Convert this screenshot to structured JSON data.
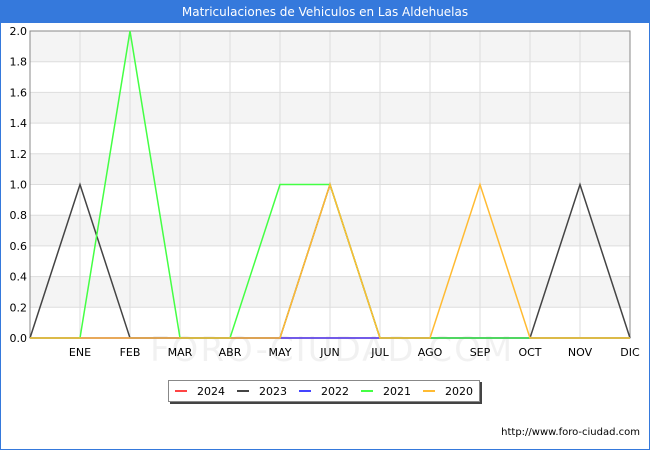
{
  "title": "Matriculaciones de Vehiculos en Las Aldehuelas",
  "footer_url": "http://www.foro-ciudad.com",
  "watermark": "FORO-CIUDAD.COM",
  "chart_data": {
    "type": "line",
    "title": "Matriculaciones de Vehiculos en Las Aldehuelas",
    "x": [
      "",
      "ENE",
      "FEB",
      "MAR",
      "ABR",
      "MAY",
      "JUN",
      "JUL",
      "AGO",
      "SEP",
      "OCT",
      "NOV",
      "DIC"
    ],
    "ylim": [
      0,
      2.0
    ],
    "yticks": [
      0.0,
      0.2,
      0.4,
      0.6,
      0.8,
      1.0,
      1.2,
      1.4,
      1.6,
      1.8,
      2.0
    ],
    "ytick_labels": [
      "0.0",
      "0.2",
      "0.4",
      "0.6",
      "0.8",
      "1.0",
      "1.2",
      "1.4",
      "1.6",
      "1.8",
      "2.0"
    ],
    "grid": true,
    "legend_position": "bottom",
    "series": [
      {
        "name": "2024",
        "color": "#ff4444",
        "values": [
          0,
          0,
          0,
          0,
          0,
          0,
          0,
          0,
          0,
          0,
          0,
          0,
          0
        ]
      },
      {
        "name": "2023",
        "color": "#444444",
        "values": [
          0,
          1,
          0,
          0,
          0,
          0,
          1,
          0,
          0,
          0,
          0,
          1,
          0
        ]
      },
      {
        "name": "2022",
        "color": "#4444ff",
        "values": [
          0,
          0,
          0,
          0,
          0,
          0,
          0,
          0,
          0,
          0,
          0,
          0,
          0
        ]
      },
      {
        "name": "2021",
        "color": "#44ff44",
        "values": [
          0,
          0,
          2,
          0,
          0,
          1,
          1,
          0,
          0,
          0,
          0,
          0,
          0
        ]
      },
      {
        "name": "2020",
        "color": "#ffbb33",
        "values": [
          0,
          0,
          0,
          0,
          0,
          0,
          1,
          0,
          0,
          1,
          0,
          0,
          0
        ]
      }
    ]
  }
}
